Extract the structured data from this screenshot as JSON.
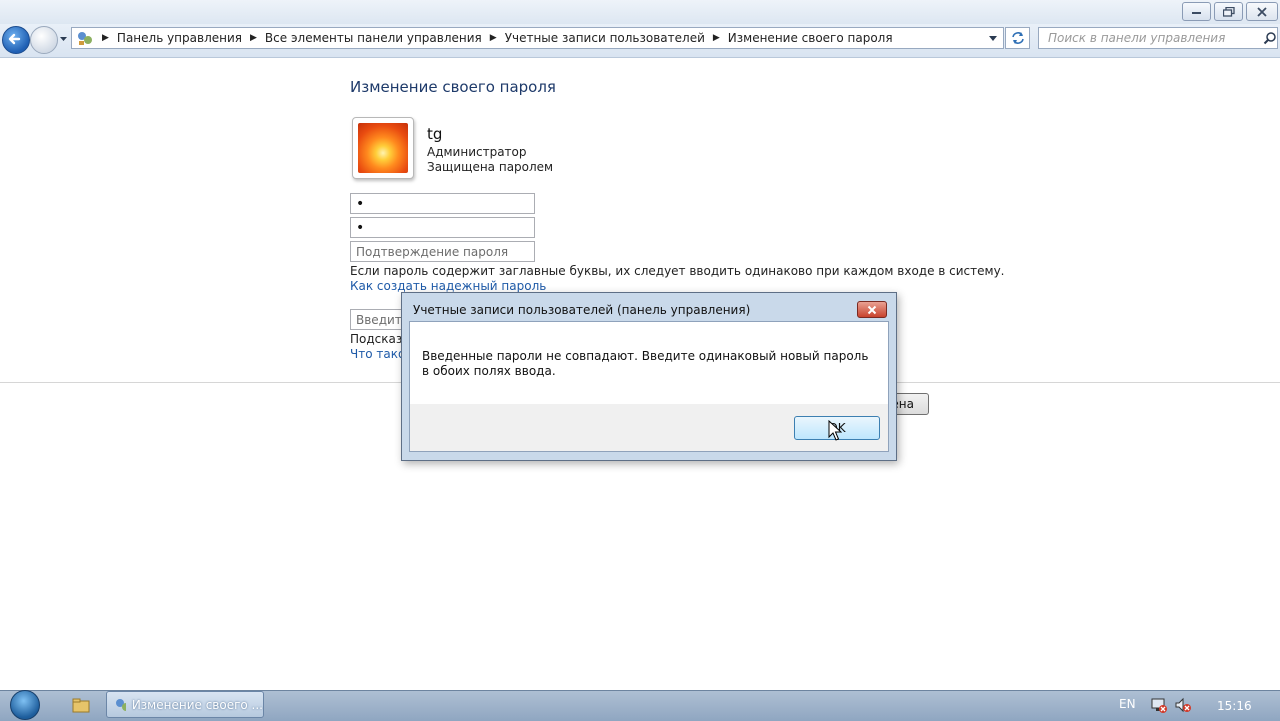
{
  "window": {
    "controls": {
      "minimize": "minimize",
      "maximize": "restore",
      "close": "close"
    }
  },
  "nav": {
    "breadcrumbs": [
      "Панель управления",
      "Все элементы панели управления",
      "Учетные записи пользователей",
      "Изменение своего пароля"
    ],
    "search_placeholder": "Поиск в панели управления"
  },
  "page": {
    "title": "Изменение своего пароля",
    "user": {
      "name": "tg",
      "role": "Администратор",
      "status": "Защищена паролем"
    },
    "current_password_value": "•",
    "new_password_value": "•",
    "confirm_placeholder": "Подтверждение пароля",
    "case_note": "Если пароль содержит заглавные буквы, их следует вводить одинаково при каждом входе в систему.",
    "strong_password_link": "Как создать надежный пароль",
    "hint_placeholder_partial": "Введите",
    "hint_label_partial": "Подсказк",
    "hint_link_partial": "Что такое",
    "cancel_button_partial": "ена"
  },
  "dialog": {
    "title": "Учетные записи пользователей (панель управления)",
    "message": "Введенные пароли не совпадают. Введите одинаковый новый пароль в обоих полях ввода.",
    "ok_label": "OK"
  },
  "taskbar": {
    "task_label": "Изменение своего ...",
    "language": "EN",
    "time": "15:16"
  },
  "colors": {
    "heading": "#1e3a6a",
    "link": "#1e5aa8",
    "dialog_frame": "#c9d9ea",
    "taskbar": "#9fb4cc"
  }
}
